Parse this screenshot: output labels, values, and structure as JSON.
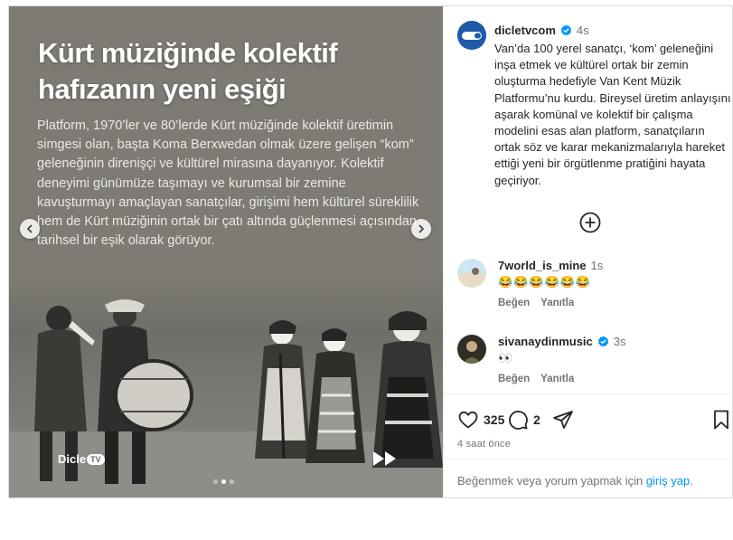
{
  "slide": {
    "title_line1": "Kürt müziğinde kolektif",
    "title_line2": "hafızanın yeni eşiği",
    "body": "Platform, 1970’ler ve 80’lerde Kürt müziğinde kolektif üretimin simgesi olan, başta Koma Berxwedan olmak üzere gelişen “kom” geleneğinin direnişçi ve kültürel mirasına dayanıyor. Kolektif deneyimi günümüze taşımayı ve kurumsal bir zemine kavuşturmayı amaçlayan sanatçılar, girişimi hem kültürel süreklilik hem de Kürt müziğinin ortak bir çatı altında güçlenmesi açısından tarihsel bir eşik olarak görüyor.",
    "logo_text": "Dicle",
    "logo_tv": "TV",
    "dot_count": 3,
    "active_dot": 1
  },
  "caption": {
    "username": "dicletvcom",
    "time": "4s",
    "text": "Van’da 100 yerel sanatçı, ‘kom’ geleneğini inşa etmek ve kültürel ortak bir zemin oluşturma hedefiyle Van Kent Müzik Platformu’nu kurdu. Bireysel üretim anlayışını aşarak komünal ve kolektif bir çalışma modelini esas alan platform, sanatçıların ortak söz ve karar mekanizmalarıyla hareket ettiği yeni bir örgütlenme pratiğini hayata geçiriyor."
  },
  "comments": [
    {
      "username": "7world_is_mine",
      "time": "1s",
      "text": "😂😂😂😂😂😂",
      "like_label": "Beğen",
      "reply_label": "Yanıtla"
    },
    {
      "username": "sivanaydinmusic",
      "time": "3s",
      "text": "👀",
      "like_label": "Beğen",
      "reply_label": "Yanıtla"
    }
  ],
  "actions": {
    "likes": "325",
    "comments": "2"
  },
  "time_ago": "4 saat önce",
  "login": {
    "prefix": "Beğenmek veya yorum yapmak için ",
    "link": "giriş yap",
    "suffix": "."
  },
  "colors": {
    "media_bg": "#7d7b73",
    "link": "#0095f6",
    "verified": "#0095f6",
    "muted": "#737373"
  }
}
